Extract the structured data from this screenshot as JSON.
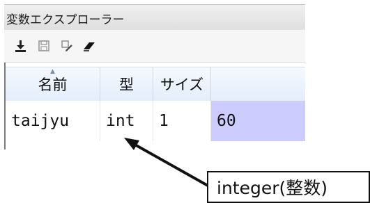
{
  "panel": {
    "title": "変数エクスプローラー"
  },
  "toolbar": {
    "buttons": [
      {
        "icon": "download-icon"
      },
      {
        "icon": "save-icon"
      },
      {
        "icon": "edit-icon"
      },
      {
        "icon": "eraser-icon"
      }
    ]
  },
  "table": {
    "columns": [
      "名前",
      "型",
      "サイズ",
      ""
    ],
    "sorted_column": "名前",
    "rows": [
      {
        "name": "taijyu",
        "type": "int",
        "size": "1",
        "value": "60"
      }
    ],
    "value_highlight_color": "#ccccff"
  },
  "annotation": {
    "label": "integer(整数)"
  }
}
